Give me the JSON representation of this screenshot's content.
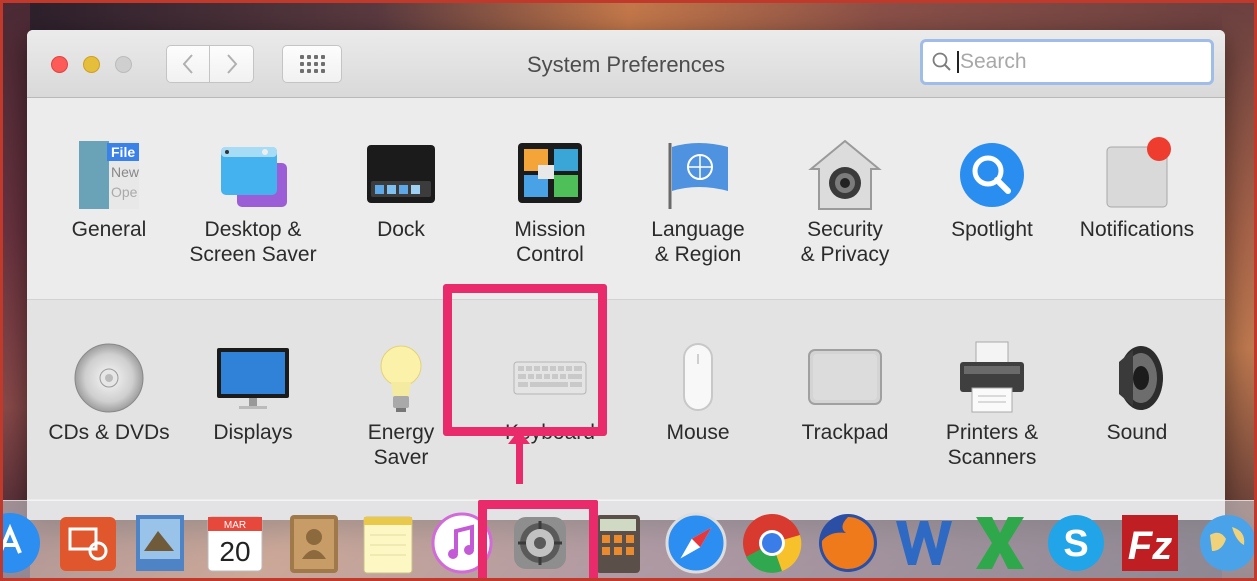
{
  "window": {
    "title": "System Preferences",
    "search_placeholder": "Search"
  },
  "row1": [
    {
      "label": "General",
      "icon": "general-icon"
    },
    {
      "label": "Desktop &\nScreen Saver",
      "icon": "desktop-screensaver-icon"
    },
    {
      "label": "Dock",
      "icon": "dock-icon"
    },
    {
      "label": "Mission\nControl",
      "icon": "mission-control-icon"
    },
    {
      "label": "Language\n& Region",
      "icon": "language-region-icon"
    },
    {
      "label": "Security\n& Privacy",
      "icon": "security-privacy-icon"
    },
    {
      "label": "Spotlight",
      "icon": "spotlight-icon"
    },
    {
      "label": "Notifications",
      "icon": "notifications-icon"
    }
  ],
  "row2": [
    {
      "label": "CDs & DVDs",
      "icon": "cds-dvds-icon"
    },
    {
      "label": "Displays",
      "icon": "displays-icon"
    },
    {
      "label": "Energy\nSaver",
      "icon": "energy-saver-icon"
    },
    {
      "label": "Keyboard",
      "icon": "keyboard-icon"
    },
    {
      "label": "Mouse",
      "icon": "mouse-icon"
    },
    {
      "label": "Trackpad",
      "icon": "trackpad-icon"
    },
    {
      "label": "Printers &\nScanners",
      "icon": "printers-scanners-icon"
    },
    {
      "label": "Sound",
      "icon": "sound-icon"
    }
  ],
  "general_icon_text": {
    "line1": "File",
    "line2": "New",
    "line3": "Ope"
  },
  "calendar": {
    "month": "MAR",
    "day": "20"
  },
  "dock": [
    "app-store-icon",
    "remote-desktop-icon",
    "preview-icon",
    "calendar-icon",
    "contacts-icon",
    "notes-icon",
    "itunes-icon",
    "system-preferences-icon",
    "calculator-icon",
    "safari-icon",
    "chrome-icon",
    "firefox-icon",
    "word-icon",
    "excel-icon",
    "skype-icon",
    "filezilla-icon",
    "network-globe-icon"
  ],
  "colors": {
    "highlight": "#e92a6b",
    "search_focus": "#9fbde7",
    "close": "#fc5b57",
    "minimize": "#e5bf3c"
  }
}
